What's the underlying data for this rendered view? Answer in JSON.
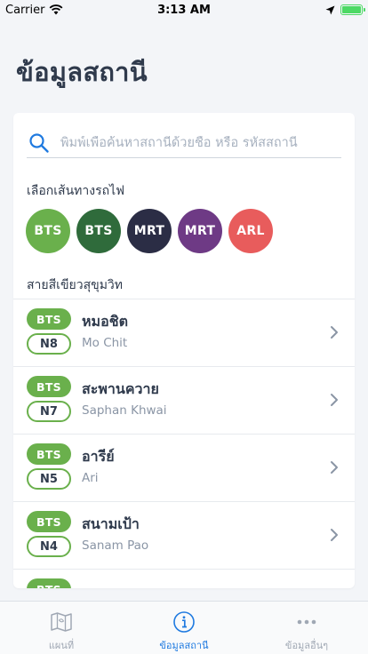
{
  "status_bar": {
    "carrier": "Carrier",
    "time": "3:13 AM"
  },
  "title": "ข้อมูลสถานี",
  "search": {
    "placeholder": "พิมพ์เพื่อค้นหาสถานีด้วยชื่อ หรือ รหัสสถานี"
  },
  "line_section_label": "เลือกเส้นทางรถไฟ",
  "lines": [
    {
      "label": "BTS",
      "color": "#6ab04c"
    },
    {
      "label": "BTS",
      "color": "#2f6b3b"
    },
    {
      "label": "MRT",
      "color": "#2b2d45"
    },
    {
      "label": "MRT",
      "color": "#6e3a85"
    },
    {
      "label": "ARL",
      "color": "#e85c5c"
    }
  ],
  "route_label": "สายสีเขียวสุขุมวิท",
  "stations": [
    {
      "system": "BTS",
      "code": "N8",
      "name_th": "หมอชิต",
      "name_en": "Mo Chit"
    },
    {
      "system": "BTS",
      "code": "N7",
      "name_th": "สะพานควาย",
      "name_en": "Saphan Khwai"
    },
    {
      "system": "BTS",
      "code": "N5",
      "name_th": "อารีย์",
      "name_en": "Ari"
    },
    {
      "system": "BTS",
      "code": "N4",
      "name_th": "สนามเป้า",
      "name_en": "Sanam Pao"
    },
    {
      "system": "BTS",
      "code": "",
      "name_th": "",
      "name_en": ""
    }
  ],
  "tabs": [
    {
      "label": "แผนที่",
      "icon": "map-icon",
      "active": false
    },
    {
      "label": "ข้อมูลสถานี",
      "icon": "info-icon",
      "active": true
    },
    {
      "label": "ข้อมูลอื่นๆ",
      "icon": "more-icon",
      "active": false
    }
  ]
}
